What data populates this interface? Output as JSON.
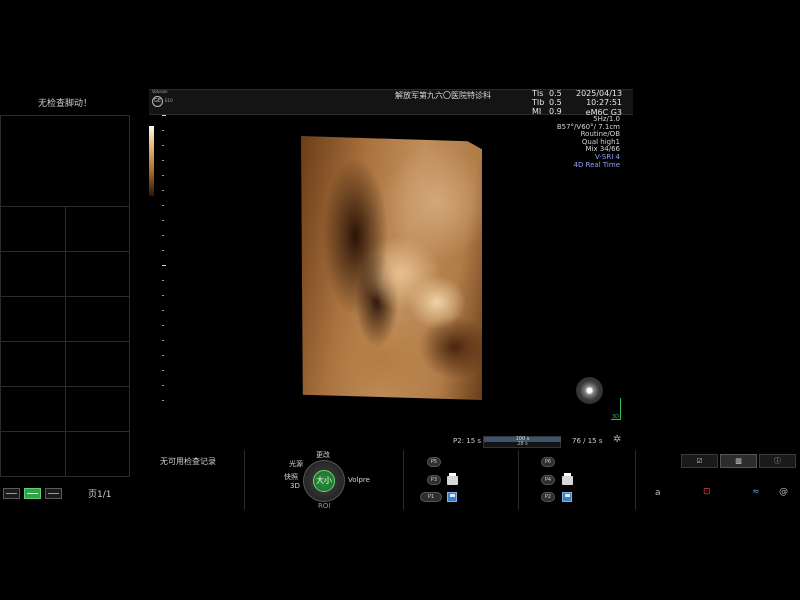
{
  "left_panel": {
    "title": "无检查脚动！",
    "page_label": "页1/1",
    "view_buttons": [
      "single-view",
      "dual-view",
      "quad-view"
    ]
  },
  "header": {
    "brand": "Voluson",
    "logo_text": "GE",
    "model": "E10",
    "hospital": "解放军第九六〇医院特诊科",
    "params": [
      {
        "label": "TIs",
        "value": "0.5"
      },
      {
        "label": "TIb",
        "value": "0.5"
      },
      {
        "label": "MI",
        "value": "0.9"
      }
    ],
    "date": "2025/04/13",
    "time": "10:27:51",
    "probe": "eM6C G3"
  },
  "image_info": [
    "5Hz/1.0",
    "B57°/V60°/ 7.1cm",
    "Routine/OB",
    "Qual high1",
    "Mix 34/66"
  ],
  "image_info_blue": [
    "V-SRI 4",
    "4D Real Time"
  ],
  "cine": {
    "left_label": "P2:",
    "left_value": "15 s",
    "bar_top": "100 s",
    "bar_bottom": "28 s",
    "right_label": "76 / 15 s"
  },
  "bottom": {
    "no_records": "无可用检查记录",
    "dial": {
      "top": "更改",
      "left_top": "光源",
      "left_mid": "快照",
      "left_bottom": "3D",
      "center": "大小",
      "right": "Volpre",
      "bottom": "ROI"
    },
    "group1": [
      "P5",
      "P3",
      "P1"
    ],
    "group2": [
      "P6",
      "P4",
      "P2"
    ]
  },
  "icons": {
    "gear": "gear-icon",
    "a_letter": "a"
  },
  "colors": {
    "accent_green": "#33a04a",
    "render_sepia": "#b07c48",
    "info_blue": "#8fa0ff"
  }
}
